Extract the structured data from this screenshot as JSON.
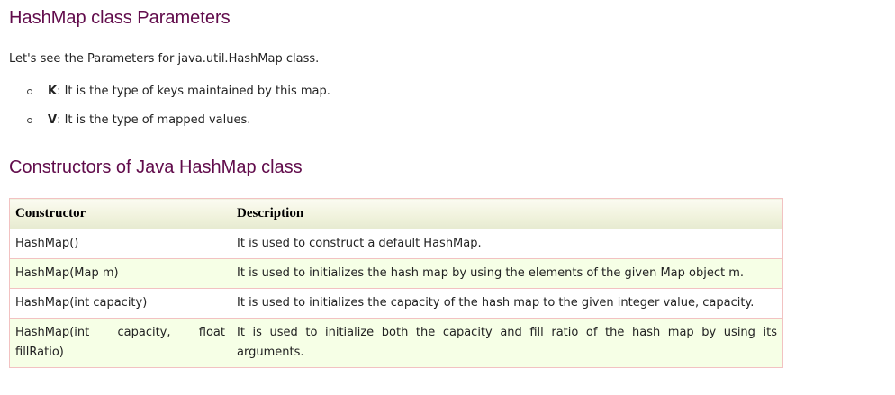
{
  "section_params": {
    "heading": "HashMap class Parameters",
    "intro": "Let's see the Parameters for java.util.HashMap class.",
    "items": [
      {
        "term": "K",
        "text": ": It is the type of keys maintained by this map."
      },
      {
        "term": "V",
        "text": ": It is the type of mapped values."
      }
    ]
  },
  "section_ctors": {
    "heading": "Constructors of Java HashMap class",
    "table": {
      "headers": [
        "Constructor",
        "Description"
      ],
      "rows": [
        [
          "HashMap()",
          "It is used to construct a default HashMap."
        ],
        [
          "HashMap(Map m)",
          "It is used to initializes the hash map by using the elements of the given Map object m."
        ],
        [
          "HashMap(int capacity)",
          "It is used to initializes the capacity of the hash map to the given integer value, capacity."
        ],
        [
          "HashMap(int capacity, float fillRatio)",
          "It is used to initialize both the capacity and fill ratio of the hash map by using its arguments."
        ]
      ]
    }
  },
  "colors": {
    "heading": "#610B4B",
    "table_border": "#F2C2C2",
    "row_alt": "#F6FFE6"
  }
}
